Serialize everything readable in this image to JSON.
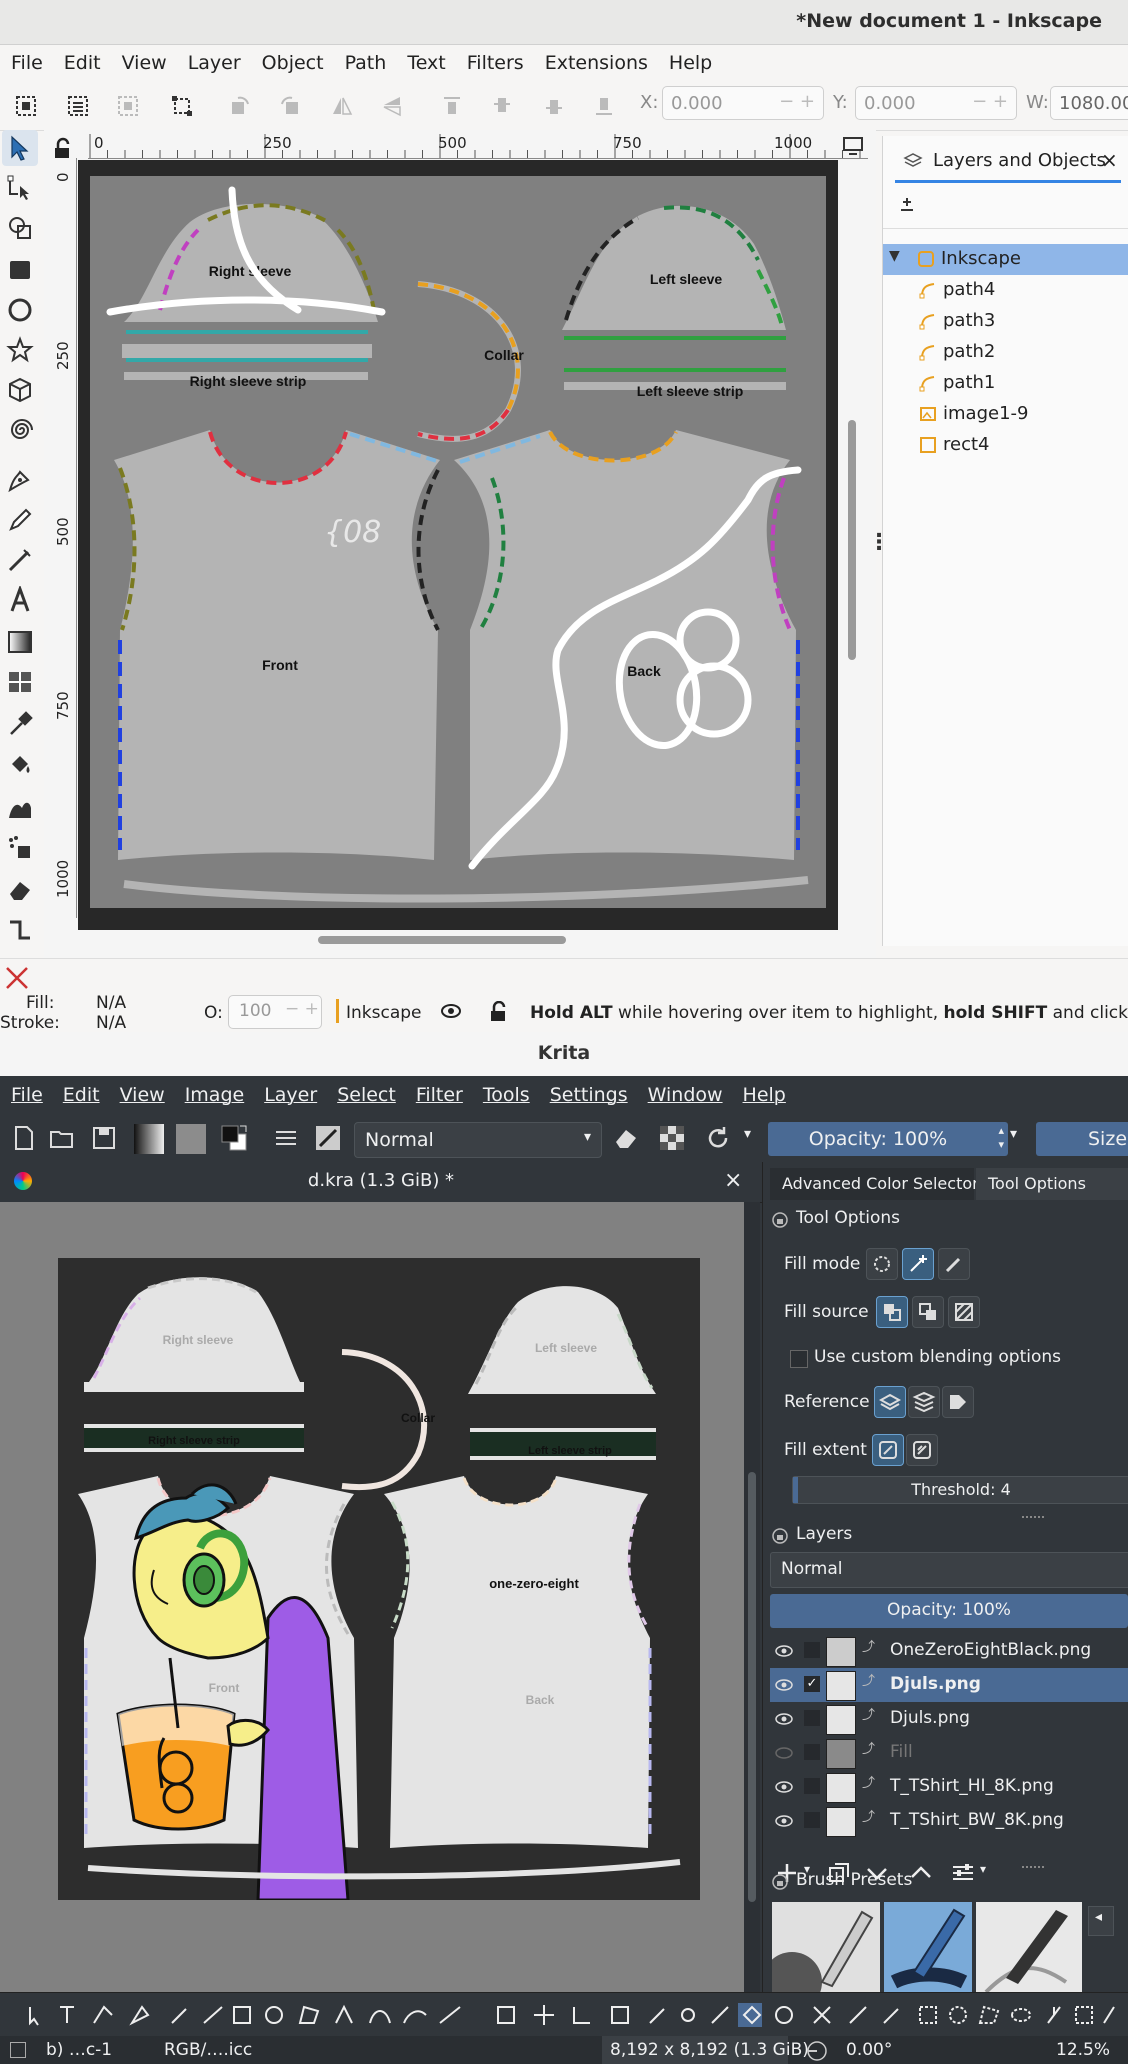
{
  "inkscape": {
    "window_title": "*New document 1 - Inkscape",
    "menu": [
      "File",
      "Edit",
      "View",
      "Layer",
      "Object",
      "Path",
      "Text",
      "Filters",
      "Extensions",
      "Help"
    ],
    "coords": {
      "x_label": "X:",
      "x_value": "0.000",
      "y_label": "Y:",
      "y_value": "0.000",
      "w_label": "W:",
      "w_value": "1080.00"
    },
    "ruler_top": [
      "0",
      "250",
      "500",
      "750",
      "1000"
    ],
    "ruler_left": [
      "0",
      "250",
      "500",
      "750",
      "1000"
    ],
    "canvas_labels": {
      "right_sleeve": "Right sleeve",
      "right_sleeve_strip": "Right sleeve strip",
      "collar": "Collar",
      "left_sleeve": "Left sleeve",
      "left_sleeve_strip": "Left sleeve strip",
      "front": "Front",
      "back": "Back"
    },
    "dialog": {
      "tab_label": "Layers and Objects",
      "close": "×",
      "layers": [
        {
          "name": "Inkscape",
          "icon": "layer-icon",
          "selected": true,
          "expanded": true
        },
        {
          "name": "path4",
          "icon": "path-icon"
        },
        {
          "name": "path3",
          "icon": "path-icon"
        },
        {
          "name": "path2",
          "icon": "path-icon"
        },
        {
          "name": "path1",
          "icon": "path-icon"
        },
        {
          "name": "image1-9",
          "icon": "image-icon"
        },
        {
          "name": "rect4",
          "icon": "rect-icon"
        }
      ]
    },
    "status": {
      "fill_label": "Fill:",
      "fill_value": "N/A",
      "stroke_label": "Stroke:",
      "stroke_value": "N/A",
      "opacity_label": "O:",
      "opacity_value": "100",
      "layer_name": "Inkscape",
      "hint_bold1": "Hold ALT",
      "hint_text1": " while hovering over item to highlight, ",
      "hint_bold2": "hold SHIFT",
      "hint_text2": " and click to hi"
    }
  },
  "krita": {
    "window_title": "Krita",
    "menu": [
      "File",
      "Edit",
      "View",
      "Image",
      "Layer",
      "Select",
      "Filter",
      "Tools",
      "Settings",
      "Window",
      "Help"
    ],
    "blend_mode": "Normal",
    "opacity": "Opacity: 100%",
    "size": "Size:",
    "doc_tab": "d.kra (1.3 GiB) *",
    "doc_close": "×",
    "canvas_labels": {
      "right_sleeve": "Right sleeve",
      "right_sleeve_strip": "Right sleeve strip",
      "collar": "Collar",
      "left_sleeve": "Left sleeve",
      "left_sleeve_strip": "Left sleeve strip",
      "front": "Front",
      "back": "Back",
      "chest_text": "one-zero-eight"
    },
    "dock_tabs": [
      "Advanced Color Selector",
      "Tool Options"
    ],
    "tool_options": {
      "header": "Tool Options",
      "fill_mode": "Fill mode",
      "fill_source": "Fill source",
      "custom_blend": "Use custom blending options",
      "reference": "Reference",
      "fill_extent": "Fill extent",
      "threshold": "Threshold: 4",
      "threshold_value": 4
    },
    "layers_docker": {
      "header": "Layers",
      "blend_mode": "Normal",
      "opacity": "Opacity:  100%",
      "layers": [
        {
          "name": "OneZeroEightBlack.png",
          "visible": true,
          "selected": false,
          "checked": false
        },
        {
          "name": "Djuls.png",
          "visible": true,
          "selected": true,
          "checked": true
        },
        {
          "name": "Djuls.png",
          "visible": true,
          "selected": false,
          "checked": false
        },
        {
          "name": "Fill",
          "visible": false,
          "selected": false,
          "checked": false
        },
        {
          "name": "T_TShirt_HI_8K.png",
          "visible": true,
          "selected": false,
          "checked": false
        },
        {
          "name": "T_TShirt_BW_8K.png",
          "visible": true,
          "selected": false,
          "checked": false
        }
      ]
    },
    "brush_presets": "Brush Presets",
    "status": {
      "left1": "b) …c-1",
      "left2": "RGB/….icc",
      "dimensions": "8,192 x 8,192 (1.3 GiB)",
      "rotation": "0.00°",
      "zoom": "12.5%"
    }
  }
}
